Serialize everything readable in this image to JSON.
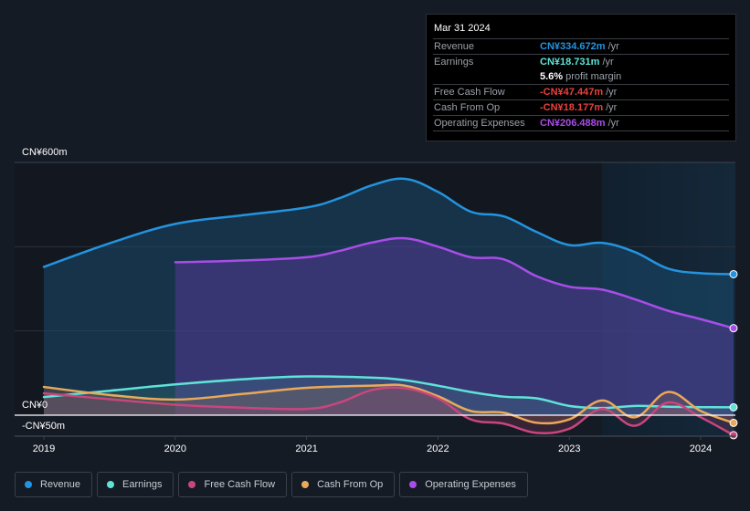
{
  "tooltip": {
    "date": "Mar 31 2024",
    "rows": [
      {
        "label": "Revenue",
        "value": "CN¥334.672m",
        "unit": "/yr",
        "color": "#2394df"
      },
      {
        "label": "Earnings",
        "value": "CN¥18.731m",
        "unit": "/yr",
        "color": "#5fe3d8"
      },
      {
        "label": "",
        "value": "5.6%",
        "unit": "profit margin",
        "color": "#ffffff"
      },
      {
        "label": "Free Cash Flow",
        "value": "-CN¥47.447m",
        "unit": "/yr",
        "color": "#e8413d"
      },
      {
        "label": "Cash From Op",
        "value": "-CN¥18.177m",
        "unit": "/yr",
        "color": "#e8413d"
      },
      {
        "label": "Operating Expenses",
        "value": "CN¥206.488m",
        "unit": "/yr",
        "color": "#a94de8"
      }
    ]
  },
  "legend": [
    {
      "label": "Revenue",
      "color": "#2394df"
    },
    {
      "label": "Earnings",
      "color": "#5fe3d8"
    },
    {
      "label": "Free Cash Flow",
      "color": "#c9467d"
    },
    {
      "label": "Cash From Op",
      "color": "#e9a95a"
    },
    {
      "label": "Operating Expenses",
      "color": "#a94de8"
    }
  ],
  "chart_data": {
    "type": "area",
    "title": "",
    "xlabel": "",
    "ylabel": "",
    "y_tick_labels": [
      {
        "value": 600,
        "label": "CN¥600m"
      },
      {
        "value": 0,
        "label": "CN¥0"
      },
      {
        "value": -50,
        "label": "-CN¥50m"
      }
    ],
    "ylim": [
      -50,
      600
    ],
    "xlim": [
      2019.0,
      2024.25
    ],
    "x_ticks": [
      2019,
      2020,
      2021,
      2022,
      2023,
      2024
    ],
    "x_tick_labels": [
      "2019",
      "2020",
      "2021",
      "2022",
      "2023",
      "2024"
    ],
    "grid": true,
    "highlight_range": [
      2023.25,
      2024.25
    ],
    "series": [
      {
        "name": "Revenue",
        "color": "#2394df",
        "x": [
          2019.0,
          2019.5,
          2020.0,
          2020.5,
          2021.0,
          2021.25,
          2021.5,
          2021.75,
          2022.0,
          2022.25,
          2022.5,
          2022.75,
          2023.0,
          2023.25,
          2023.5,
          2023.75,
          2024.0,
          2024.25
        ],
        "values": [
          352,
          408,
          454,
          474,
          493,
          515,
          546,
          561,
          530,
          483,
          472,
          435,
          404,
          409,
          387,
          348,
          337,
          334.672
        ]
      },
      {
        "name": "Operating Expenses",
        "color": "#a94de8",
        "x": [
          2020.0,
          2020.5,
          2021.0,
          2021.25,
          2021.5,
          2021.75,
          2022.0,
          2022.25,
          2022.5,
          2022.75,
          2023.0,
          2023.25,
          2023.5,
          2023.75,
          2024.0,
          2024.25
        ],
        "values": [
          363,
          367,
          375,
          390,
          410,
          420,
          400,
          375,
          370,
          330,
          305,
          298,
          275,
          248,
          228,
          206.488
        ]
      },
      {
        "name": "Earnings",
        "color": "#5fe3d8",
        "x": [
          2019.0,
          2019.5,
          2020.0,
          2020.5,
          2021.0,
          2021.5,
          2021.75,
          2022.0,
          2022.25,
          2022.5,
          2022.75,
          2023.0,
          2023.25,
          2023.5,
          2023.75,
          2024.0,
          2024.25
        ],
        "values": [
          43,
          58,
          73,
          85,
          92,
          89,
          83,
          70,
          55,
          44,
          40,
          22,
          17,
          22,
          20,
          19,
          18.731
        ]
      },
      {
        "name": "Cash From Op",
        "color": "#e9a95a",
        "x": [
          2019.0,
          2019.5,
          2020.0,
          2020.5,
          2021.0,
          2021.5,
          2021.75,
          2022.0,
          2022.25,
          2022.5,
          2022.75,
          2023.0,
          2023.25,
          2023.5,
          2023.75,
          2024.0,
          2024.25
        ],
        "values": [
          67,
          48,
          37,
          50,
          65,
          70,
          70,
          45,
          10,
          6,
          -18,
          -10,
          35,
          -5,
          55,
          10,
          -18.177
        ]
      },
      {
        "name": "Free Cash Flow",
        "color": "#c9467d",
        "x": [
          2019.0,
          2019.5,
          2020.0,
          2020.5,
          2021.0,
          2021.25,
          2021.5,
          2021.75,
          2022.0,
          2022.25,
          2022.5,
          2022.75,
          2023.0,
          2023.25,
          2023.5,
          2023.75,
          2024.0,
          2024.25
        ],
        "values": [
          52,
          38,
          25,
          18,
          15,
          30,
          60,
          64,
          40,
          -10,
          -20,
          -42,
          -32,
          15,
          -25,
          30,
          -5,
          -47.447
        ]
      }
    ]
  }
}
